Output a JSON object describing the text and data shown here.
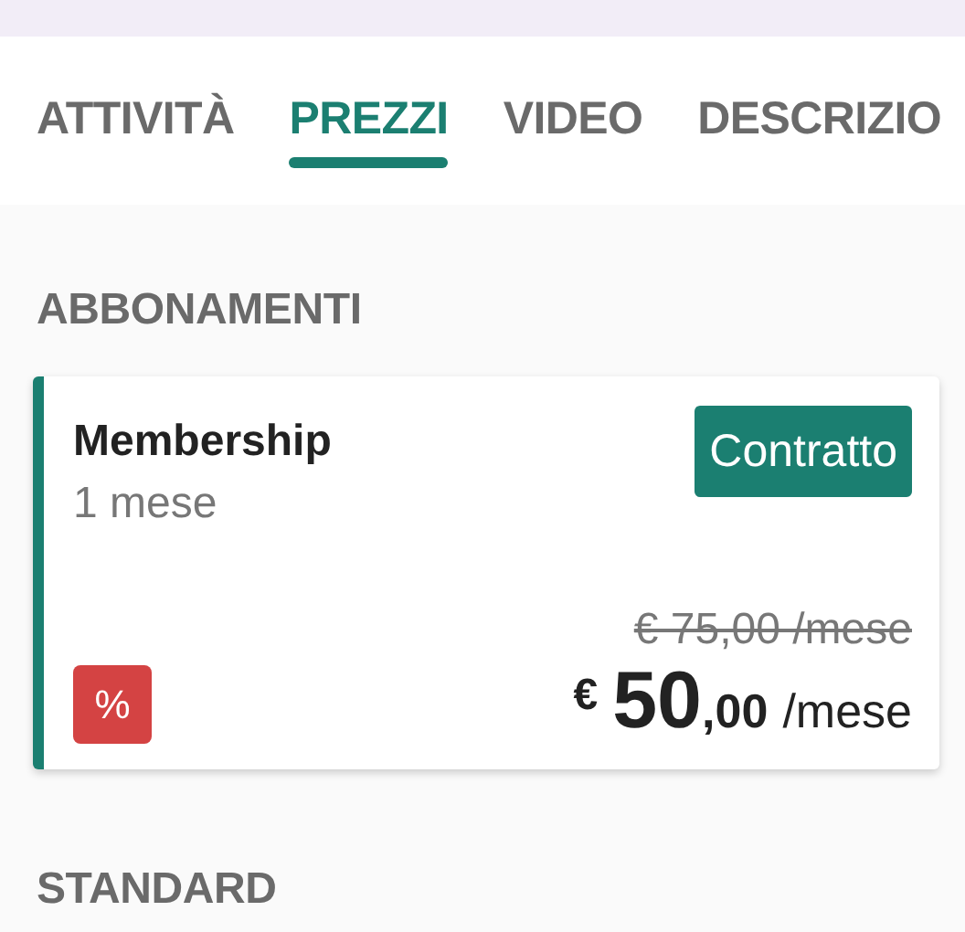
{
  "tabs": [
    {
      "label": "ATTIVITÀ",
      "selected": false
    },
    {
      "label": "PREZZI",
      "selected": true
    },
    {
      "label": "VIDEO",
      "selected": false
    },
    {
      "label": "DESCRIZIO",
      "selected": false
    }
  ],
  "sections": [
    {
      "title": "ABBONAMENTI",
      "plans": [
        {
          "name": "Membership",
          "duration": "1 mese",
          "action": "Contratto",
          "badge": "%",
          "old_price": "€ 75,00 /mese",
          "price": {
            "currency": "€",
            "whole": "50",
            "decimals": ",00",
            "unit": "/mese"
          }
        }
      ]
    },
    {
      "title": "STANDARD"
    }
  ]
}
